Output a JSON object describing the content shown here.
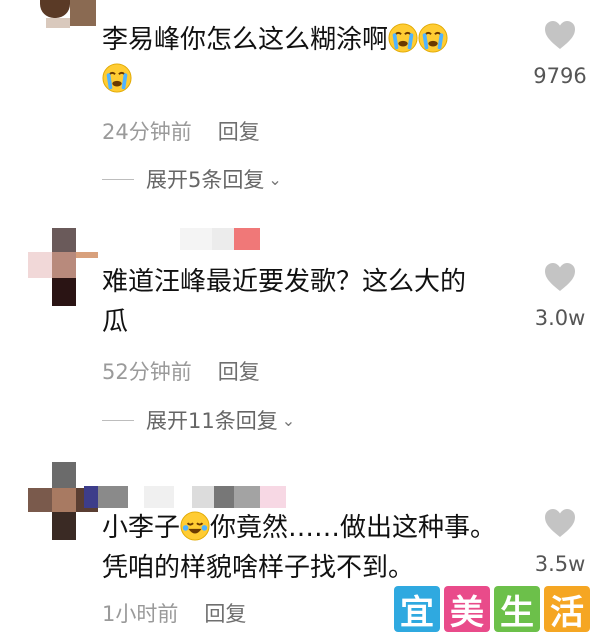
{
  "comments": [
    {
      "text": "李易峰你怎么这么糊涂啊",
      "time": "24分钟前",
      "reply_label": "回复",
      "expand_label": "展开5条回复",
      "like_count": "9796"
    },
    {
      "text_line1": "难道汪峰最近要发歌？这么大的",
      "text_line2": "瓜",
      "time": "52分钟前",
      "reply_label": "回复",
      "expand_label": "展开11条回复",
      "like_count": "3.0w"
    },
    {
      "text_part1": "小李子",
      "text_part2": "你竟然……做出这种事。",
      "text_line2": "凭咱的样貌啥样子找不到。",
      "time": "1小时前",
      "reply_label": "回复",
      "like_count": "3.5w"
    }
  ],
  "watermark": [
    "宜",
    "美",
    "生",
    "活"
  ],
  "colors": {
    "like_heart": "#c4c4c4",
    "meta_text": "#9a9a9a",
    "watermark_1": "#2fa9e0",
    "watermark_2": "#e94b8a",
    "watermark_3": "#6cc04a",
    "watermark_4": "#f5a623"
  },
  "icons": [
    "heart-icon",
    "crying-emoji-icon",
    "laughing-crying-emoji-icon",
    "chevron-down-icon"
  ]
}
